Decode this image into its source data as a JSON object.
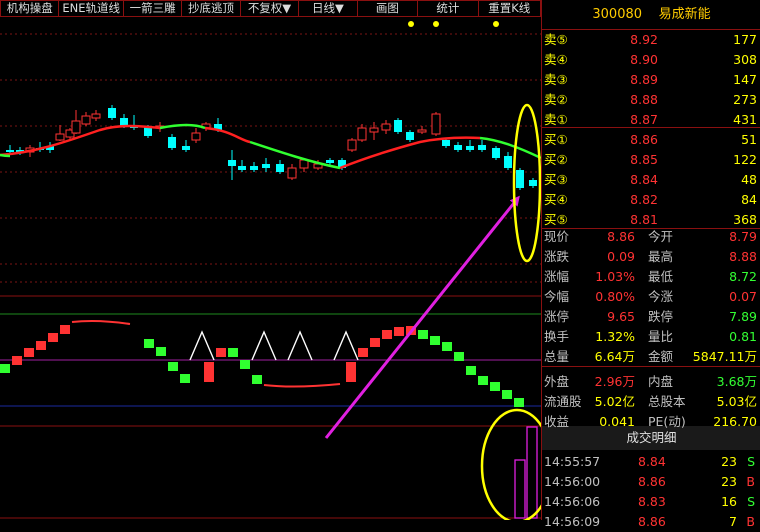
{
  "toolbar": {
    "buttons": [
      "机构操盘",
      "ENE轨道线",
      "一箭三雕",
      "抄底逃顶",
      "不复权▼",
      "日线▼",
      "画图",
      "统计",
      "重置K线"
    ]
  },
  "stock": {
    "code": "300080",
    "name": "易成新能"
  },
  "orderbook": {
    "sell": [
      {
        "label": "卖⑤",
        "price": "8.92",
        "vol": "177"
      },
      {
        "label": "卖④",
        "price": "8.90",
        "vol": "308"
      },
      {
        "label": "卖③",
        "price": "8.89",
        "vol": "147"
      },
      {
        "label": "卖②",
        "price": "8.88",
        "vol": "273"
      },
      {
        "label": "卖①",
        "price": "8.87",
        "vol": "431"
      }
    ],
    "buy": [
      {
        "label": "买①",
        "price": "8.86",
        "vol": "51"
      },
      {
        "label": "买②",
        "price": "8.85",
        "vol": "122"
      },
      {
        "label": "买③",
        "price": "8.84",
        "vol": "48"
      },
      {
        "label": "买④",
        "price": "8.82",
        "vol": "84"
      },
      {
        "label": "买⑤",
        "price": "8.81",
        "vol": "368"
      }
    ]
  },
  "quote": [
    {
      "l1": "现价",
      "v1": "8.86",
      "c1": "red",
      "l2": "今开",
      "v2": "8.79",
      "c2": "red"
    },
    {
      "l1": "涨跌",
      "v1": "0.09",
      "c1": "red",
      "l2": "最高",
      "v2": "8.88",
      "c2": "red"
    },
    {
      "l1": "涨幅",
      "v1": "1.03%",
      "c1": "red",
      "l2": "最低",
      "v2": "8.72",
      "c2": "green"
    },
    {
      "l1": "今幅",
      "v1": "0.80%",
      "c1": "red",
      "l2": "今涨",
      "v2": "0.07",
      "c2": "red"
    },
    {
      "l1": "涨停",
      "v1": "9.65",
      "c1": "red",
      "l2": "跌停",
      "v2": "7.89",
      "c2": "green"
    },
    {
      "l1": "换手",
      "v1": "1.32%",
      "c1": "yellow",
      "l2": "量比",
      "v2": "0.81",
      "c2": "green"
    },
    {
      "l1": "总量",
      "v1": "6.64万",
      "c1": "yellow",
      "l2": "金额",
      "v2": "5847.11万",
      "c2": "yellow"
    },
    {
      "l1": "外盘",
      "v1": "2.96万",
      "c1": "red",
      "l2": "内盘",
      "v2": "3.68万",
      "c2": "green"
    },
    {
      "l1": "流通股",
      "v1": "5.02亿",
      "c1": "yellow",
      "l2": "总股本",
      "v2": "5.03亿",
      "c2": "yellow"
    },
    {
      "l1": "收益",
      "v1": "0.041",
      "c1": "yellow",
      "l2": "PE(动)",
      "v2": "216.70",
      "c2": "yellow"
    }
  ],
  "detail": {
    "title": "成交明细",
    "rows": [
      {
        "time": "14:55:57",
        "price": "8.84",
        "vol": "23",
        "dir": "S"
      },
      {
        "time": "14:56:00",
        "price": "8.86",
        "vol": "23",
        "dir": "B"
      },
      {
        "time": "14:56:06",
        "price": "8.83",
        "vol": "16",
        "dir": "S"
      },
      {
        "time": "14:56:09",
        "price": "8.86",
        "vol": "7",
        "dir": "B"
      }
    ]
  },
  "colors": {
    "up": "#ff3333",
    "down": "#00ffff",
    "ma_up": "#ff2020",
    "ma_down": "#30ff30",
    "border": "#8a1010",
    "accent": "#ffff00",
    "arrow": "#e020e0"
  }
}
